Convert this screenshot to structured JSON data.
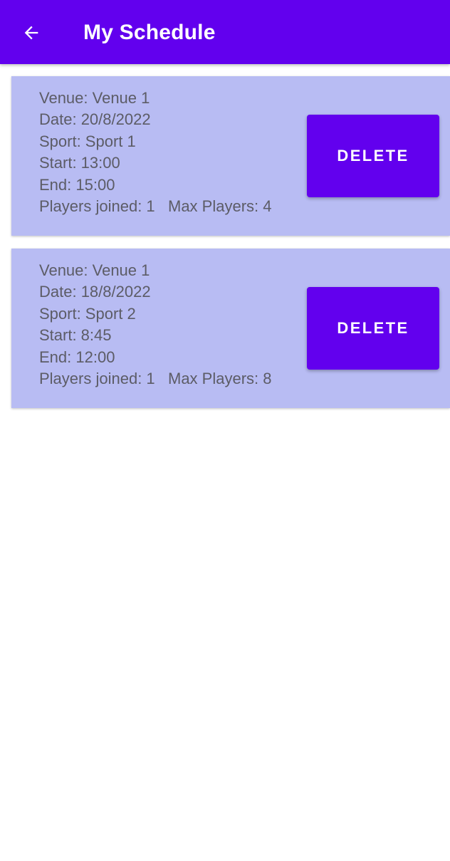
{
  "header": {
    "title": "My Schedule",
    "back_icon": "arrow-back-icon",
    "background": "#6200EE"
  },
  "colors": {
    "card_background": "#B8BCF3",
    "accent": "#6200EE",
    "text": "#5c5c66"
  },
  "schedule": [
    {
      "venue": "Venue: Venue 1",
      "date": "Date: 20/8/2022",
      "sport": "Sport: Sport 1",
      "start": "Start: 13:00",
      "end": "End: 15:00",
      "players_joined": "Players joined: 1",
      "max_players": "Max Players: 4",
      "delete_label": "DELETE"
    },
    {
      "venue": "Venue: Venue 1",
      "date": "Date: 18/8/2022",
      "sport": "Sport: Sport 2",
      "start": "Start: 8:45",
      "end": "End: 12:00",
      "players_joined": "Players joined: 1",
      "max_players": "Max Players: 8",
      "delete_label": "DELETE"
    }
  ]
}
